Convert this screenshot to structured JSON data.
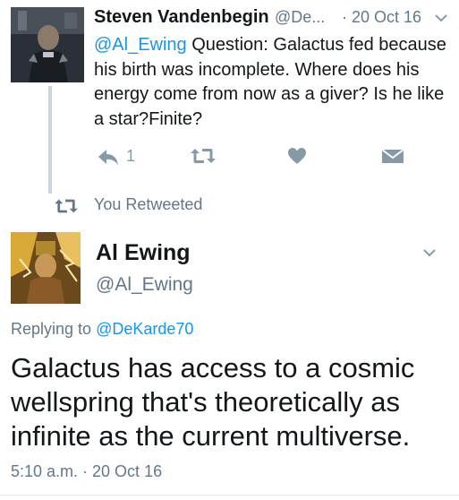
{
  "tweet1": {
    "name": "Steven Vandenbegin",
    "handle": "@De...",
    "date": "· 20 Oct 16",
    "mention": "@Al_Ewing",
    "text": " Question: Galactus fed because his birth was incomplete. Where does his energy come from now as a giver? Is he like a star?Finite?",
    "reply_count": "1"
  },
  "retweet_label": "You Retweeted",
  "tweet2": {
    "name": "Al Ewing",
    "handle": "@Al_Ewing",
    "replying_prefix": "Replying to ",
    "replying_to": "@DeKarde70",
    "text": "Galactus has access to a cosmic wellspring that's theoretically as infinite as the current multiverse.",
    "timestamp": "5:10 a.m. · 20 Oct 16"
  },
  "colors": {
    "link": "#1b95e0",
    "secondary_text": "#657786",
    "action_icon": "#8899a6"
  },
  "icons": [
    "reply-icon",
    "retweet-icon",
    "like-icon",
    "direct-message-icon",
    "chevron-down-icon"
  ]
}
